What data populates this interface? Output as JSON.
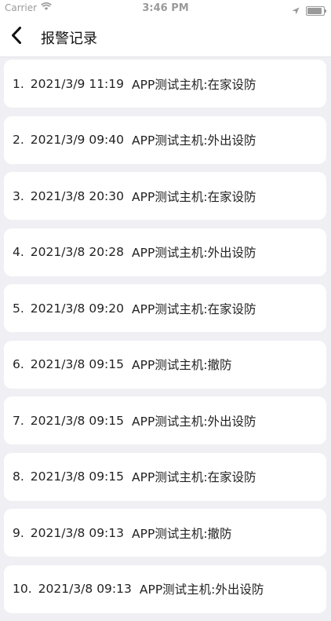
{
  "status_bar": {
    "carrier": "Carrier",
    "time": "3:46 PM"
  },
  "nav": {
    "title": "报警记录"
  },
  "records": [
    {
      "index": "1.",
      "datetime": "2021/3/9 11:19",
      "message": "APP测试主机:在家设防"
    },
    {
      "index": "2.",
      "datetime": "2021/3/9 09:40",
      "message": "APP测试主机:外出设防"
    },
    {
      "index": "3.",
      "datetime": "2021/3/8 20:30",
      "message": "APP测试主机:在家设防"
    },
    {
      "index": "4.",
      "datetime": "2021/3/8 20:28",
      "message": "APP测试主机:外出设防"
    },
    {
      "index": "5.",
      "datetime": "2021/3/8 09:20",
      "message": "APP测试主机:在家设防"
    },
    {
      "index": "6.",
      "datetime": "2021/3/8 09:15",
      "message": "APP测试主机:撤防"
    },
    {
      "index": "7.",
      "datetime": "2021/3/8 09:15",
      "message": "APP测试主机:外出设防"
    },
    {
      "index": "8.",
      "datetime": "2021/3/8 09:15",
      "message": "APP测试主机:在家设防"
    },
    {
      "index": "9.",
      "datetime": "2021/3/8 09:13",
      "message": "APP测试主机:撤防"
    },
    {
      "index": "10.",
      "datetime": "2021/3/8 09:13",
      "message": "APP测试主机:外出设防"
    }
  ]
}
